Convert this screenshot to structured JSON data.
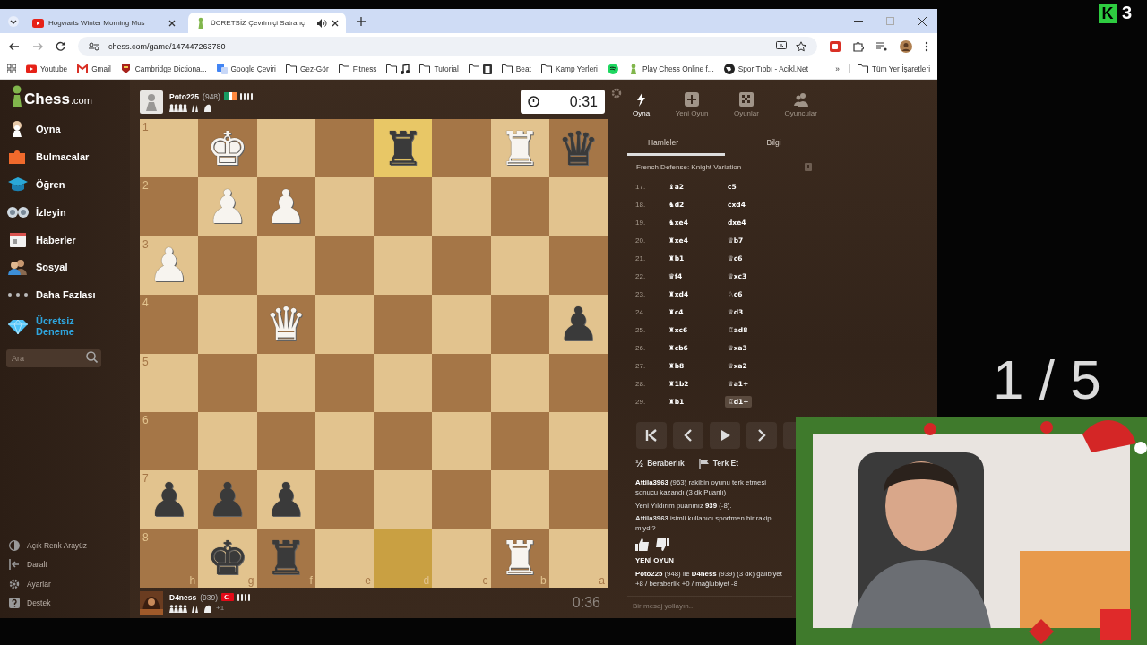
{
  "browser": {
    "tabs": [
      {
        "title": "Hogwarts Winter Morning Mus",
        "kind": "youtube",
        "selected": false,
        "audio": false
      },
      {
        "title": "ÜCRETSİZ Çevrimiçi Satranç",
        "kind": "chess",
        "selected": true,
        "audio": true
      }
    ],
    "url": "chess.com/game/147447263780",
    "bookmarks": [
      {
        "kind": "youtube",
        "label": "Youtube"
      },
      {
        "kind": "gmail",
        "label": "Gmail"
      },
      {
        "kind": "site",
        "label": "Cambridge Dictiona..."
      },
      {
        "kind": "translate",
        "label": "Google Çeviri"
      },
      {
        "kind": "folder",
        "label": "Gez-Gör"
      },
      {
        "kind": "folder",
        "label": "Fitness"
      },
      {
        "kind": "folder-music"
      },
      {
        "kind": "folder",
        "label": "Tutorial"
      },
      {
        "kind": "folder-film"
      },
      {
        "kind": "folder",
        "label": "Beat"
      },
      {
        "kind": "folder",
        "label": "Kamp Yerleri"
      },
      {
        "kind": "spotify"
      },
      {
        "kind": "chess",
        "label": "Play Chess Online f..."
      },
      {
        "kind": "globe",
        "label": "Spor Tıbbı - Acikl.Net"
      }
    ],
    "more_bookmarks": "»",
    "all_bookmarks": "Tüm Yer İşaretleri"
  },
  "sidebar": {
    "logo": {
      "name": "Chess",
      "suffix": ".com"
    },
    "items": [
      {
        "kind": "play",
        "label": "Oyna",
        "highlighted": false
      },
      {
        "kind": "puzzle",
        "label": "Bulmacalar",
        "highlighted": false
      },
      {
        "kind": "learn",
        "label": "Öğren",
        "highlighted": false
      },
      {
        "kind": "watch",
        "label": "İzleyin",
        "highlighted": false
      },
      {
        "kind": "news",
        "label": "Haberler",
        "highlighted": false
      },
      {
        "kind": "social",
        "label": "Sosyal",
        "highlighted": false
      },
      {
        "kind": "more",
        "label": "Daha Fazlası",
        "highlighted": false
      },
      {
        "kind": "diamond",
        "label": "Ücretsiz Deneme",
        "highlighted": true
      }
    ],
    "search": {
      "placeholder": "Ara"
    },
    "footer": [
      {
        "kind": "contrast",
        "label": "Açık Renk Arayüz"
      },
      {
        "kind": "collapse",
        "label": "Daralt"
      },
      {
        "kind": "settings",
        "label": "Ayarlar"
      },
      {
        "kind": "help",
        "label": "Destek"
      }
    ]
  },
  "players": [
    {
      "kind": "pawn-avatar",
      "name": "Poto225",
      "rating": "(948)",
      "flag": {
        "kind": "ireland"
      },
      "clock": "0:31",
      "active": true
    },
    {
      "kind": "photo-avatar",
      "name": "D4ness",
      "rating": "(939)",
      "flag": {
        "kind": "turkey"
      },
      "advantage": "+1",
      "clock": "0:36",
      "active": false
    }
  ],
  "board": {
    "files": [
      "h",
      "g",
      "f",
      "e",
      "d",
      "c",
      "b",
      "a"
    ],
    "rows": [
      {
        "rank": "1",
        "squares": [
          {
            "highlighted": false
          },
          {
            "highlighted": false,
            "piece": "♚",
            "color": "#f7f4ef"
          },
          {
            "highlighted": false
          },
          {
            "highlighted": false
          },
          {
            "highlighted": true,
            "piece": "♜",
            "color": "#3a3a3a"
          },
          {
            "highlighted": false
          },
          {
            "highlighted": false,
            "piece": "♜",
            "color": "#f7f4ef"
          },
          {
            "highlighted": false,
            "piece": "♛",
            "color": "#3a3a3a"
          }
        ]
      },
      {
        "rank": "2",
        "squares": [
          {
            "highlighted": false
          },
          {
            "highlighted": false,
            "piece": "♟",
            "color": "#f7f4ef"
          },
          {
            "highlighted": false,
            "piece": "♟",
            "color": "#f7f4ef"
          },
          {
            "highlighted": false
          },
          {
            "highlighted": false
          },
          {
            "highlighted": false
          },
          {
            "highlighted": false
          },
          {
            "highlighted": false
          }
        ]
      },
      {
        "rank": "3",
        "squares": [
          {
            "highlighted": false,
            "piece": "♟",
            "color": "#f7f4ef"
          },
          {
            "highlighted": false
          },
          {
            "highlighted": false
          },
          {
            "highlighted": false
          },
          {
            "highlighted": false
          },
          {
            "highlighted": false
          },
          {
            "highlighted": false
          },
          {
            "highlighted": false
          }
        ]
      },
      {
        "rank": "4",
        "squares": [
          {
            "highlighted": false
          },
          {
            "highlighted": false
          },
          {
            "highlighted": false,
            "piece": "♛",
            "color": "#f7f4ef"
          },
          {
            "highlighted": false
          },
          {
            "highlighted": false
          },
          {
            "highlighted": false
          },
          {
            "highlighted": false
          },
          {
            "highlighted": false,
            "piece": "♟",
            "color": "#3a3a3a"
          }
        ]
      },
      {
        "rank": "5",
        "squares": [
          {
            "highlighted": false
          },
          {
            "highlighted": false
          },
          {
            "highlighted": false
          },
          {
            "highlighted": false
          },
          {
            "highlighted": false
          },
          {
            "highlighted": false
          },
          {
            "highlighted": false
          },
          {
            "highlighted": false
          }
        ]
      },
      {
        "rank": "6",
        "squares": [
          {
            "highlighted": false
          },
          {
            "highlighted": false
          },
          {
            "highlighted": false
          },
          {
            "highlighted": false
          },
          {
            "highlighted": false
          },
          {
            "highlighted": false
          },
          {
            "highlighted": false
          },
          {
            "highlighted": false
          }
        ]
      },
      {
        "rank": "7",
        "squares": [
          {
            "highlighted": false,
            "piece": "♟",
            "color": "#3a3a3a"
          },
          {
            "highlighted": false,
            "piece": "♟",
            "color": "#3a3a3a"
          },
          {
            "highlighted": false,
            "piece": "♟",
            "color": "#3a3a3a"
          },
          {
            "highlighted": false
          },
          {
            "highlighted": false
          },
          {
            "highlighted": false
          },
          {
            "highlighted": false
          },
          {
            "highlighted": false
          }
        ]
      },
      {
        "rank": "8",
        "squares": [
          {
            "highlighted": false
          },
          {
            "highlighted": false,
            "piece": "♚",
            "color": "#3a3a3a"
          },
          {
            "highlighted": false,
            "piece": "♜",
            "color": "#3a3a3a"
          },
          {
            "highlighted": false
          },
          {
            "highlighted": true
          },
          {
            "highlighted": false
          },
          {
            "highlighted": false,
            "piece": "♜",
            "color": "#f7f4ef"
          },
          {
            "highlighted": false
          }
        ]
      }
    ]
  },
  "panel": {
    "nav": [
      {
        "kind": "bolt",
        "label": "Oyna",
        "selected": true
      },
      {
        "kind": "plus",
        "label": "Yeni Oyun",
        "selected": false
      },
      {
        "kind": "board",
        "label": "Oyunlar",
        "selected": false
      },
      {
        "kind": "people",
        "label": "Oyuncular",
        "selected": false
      }
    ],
    "tabs": [
      {
        "label": "Hamleler",
        "selected": true
      },
      {
        "label": "Bilgi",
        "selected": false
      }
    ],
    "opening": "French Defense: Knight Variation",
    "moves": [
      {
        "number": "17.",
        "white": {
          "text": "♝a2",
          "selected": false
        },
        "black": {
          "text": "c5",
          "selected": false
        }
      },
      {
        "number": "18.",
        "white": {
          "text": "♞d2",
          "selected": false
        },
        "black": {
          "text": "cxd4",
          "selected": false
        }
      },
      {
        "number": "19.",
        "white": {
          "text": "♞xe4",
          "selected": false
        },
        "black": {
          "text": "dxe4",
          "selected": false
        }
      },
      {
        "number": "20.",
        "white": {
          "text": "♜xe4",
          "selected": false
        },
        "black": {
          "text": "♕b7",
          "selected": false
        }
      },
      {
        "number": "21.",
        "white": {
          "text": "♜b1",
          "selected": false
        },
        "black": {
          "text": "♕c6",
          "selected": false
        }
      },
      {
        "number": "22.",
        "white": {
          "text": "♛f4",
          "selected": false
        },
        "black": {
          "text": "♕xc3",
          "selected": false
        }
      },
      {
        "number": "23.",
        "white": {
          "text": "♜xd4",
          "selected": false
        },
        "black": {
          "text": "♘c6",
          "selected": false
        }
      },
      {
        "number": "24.",
        "white": {
          "text": "♜c4",
          "selected": false
        },
        "black": {
          "text": "♕d3",
          "selected": false
        }
      },
      {
        "number": "25.",
        "white": {
          "text": "♜xc6",
          "selected": false
        },
        "black": {
          "text": "♖ad8",
          "selected": false
        }
      },
      {
        "number": "26.",
        "white": {
          "text": "♜cb6",
          "selected": false
        },
        "black": {
          "text": "♕xa3",
          "selected": false
        }
      },
      {
        "number": "27.",
        "white": {
          "text": "♜b8",
          "selected": false
        },
        "black": {
          "text": "♕xa2",
          "selected": false
        }
      },
      {
        "number": "28.",
        "white": {
          "text": "♜1b2",
          "selected": false
        },
        "black": {
          "text": "♕a1+",
          "selected": false
        }
      },
      {
        "number": "29.",
        "white": {
          "text": "♜b1",
          "selected": false
        },
        "black": {
          "text": "♖d1+",
          "selected": true
        }
      }
    ],
    "actions": [
      {
        "kind": "half",
        "label": "Beraberlik",
        "mark": "½"
      },
      {
        "kind": "flag",
        "label": "Terk Et"
      }
    ],
    "chat": [
      {
        "kind": "message",
        "text": "**Attila3963** (963) rakibin oyunu terk etmesi sonucu kazandı (3 dk Puanlı)"
      },
      {
        "kind": "message",
        "text": "Yeni Yıldırım puanınız **939** (-8)."
      },
      {
        "kind": "feedback",
        "text": "**Attila3963** isimli kullanıcı sportmen bir rakip miydi?"
      },
      {
        "kind": "heading",
        "text": "YENİ OYUN"
      },
      {
        "kind": "message",
        "text": "**Poto225** (948) ile **D4ness** (939) (3 dk) galibiyet +8 / beraberlik +0 / mağlubiyet -8"
      }
    ],
    "message_placeholder": "Bir mesaj yollayın..."
  },
  "stream": {
    "logo": "K",
    "counter": "3",
    "page_counter": "1 / 5"
  }
}
